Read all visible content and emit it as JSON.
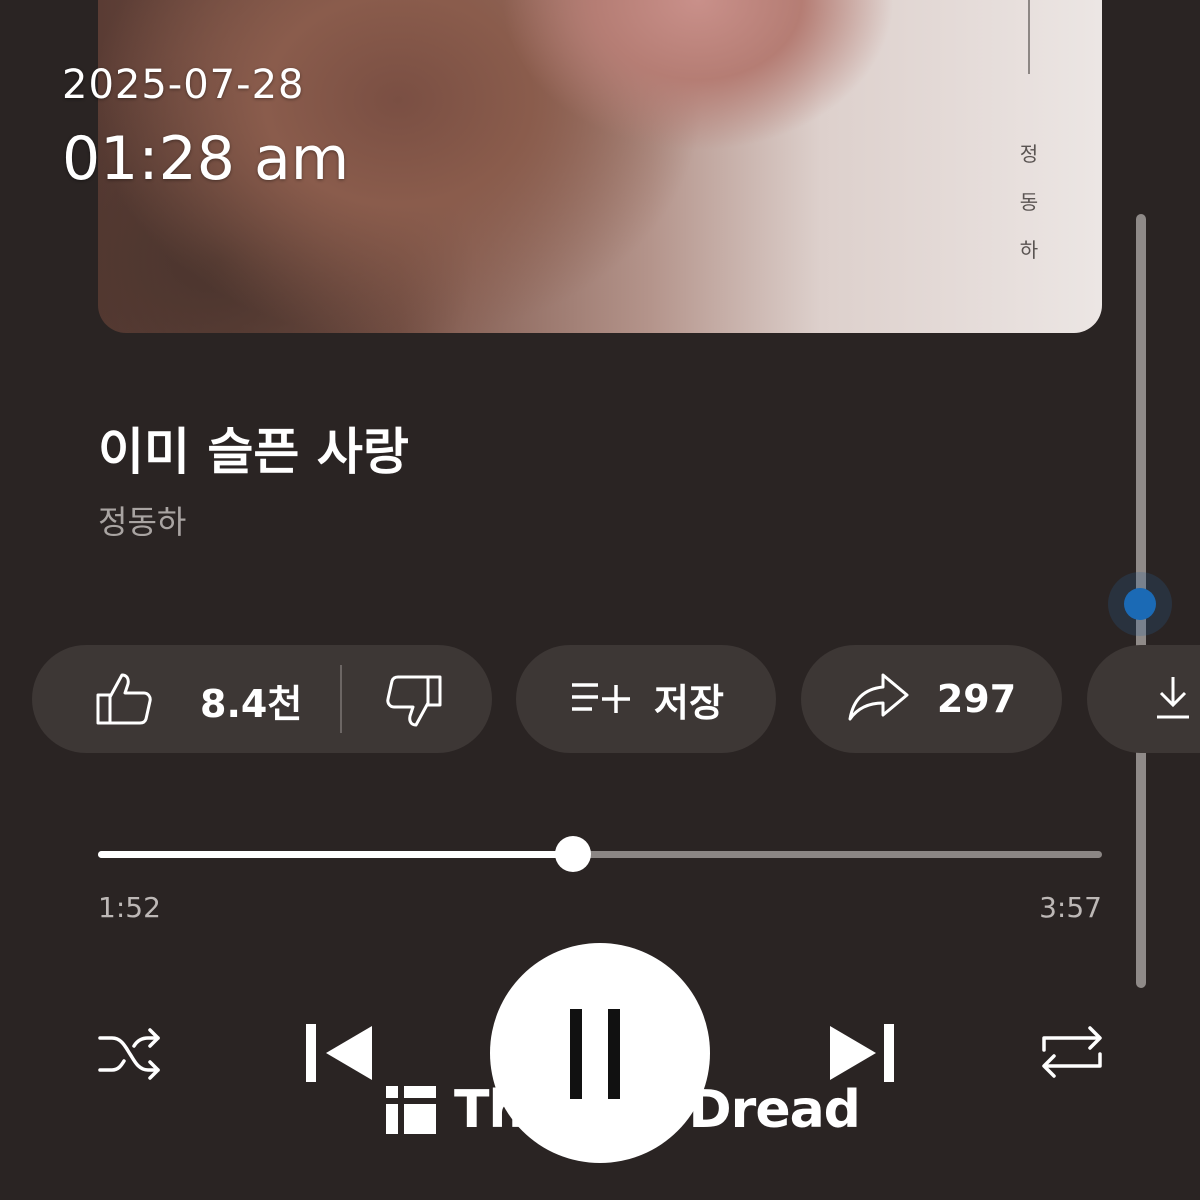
{
  "overlay": {
    "date": "2025-07-28",
    "time": "01:28 am"
  },
  "album_art": {
    "vertical_artist_chars": [
      "정",
      "동",
      "하"
    ]
  },
  "song": {
    "title": "이미 슬픈 사랑",
    "artist": "정동하"
  },
  "actions": {
    "like_count": "8.4천",
    "save_label": "저장",
    "share_count": "297"
  },
  "playback": {
    "elapsed": "1:52",
    "total": "3:57",
    "progress_fraction": 0.473
  },
  "watermark": {
    "text": "TheQoo Dread"
  },
  "icons": {
    "like": "thumbs-up-icon",
    "dislike": "thumbs-down-icon",
    "save": "playlist-add-icon",
    "share": "share-arrow-icon",
    "download": "download-icon",
    "shuffle": "shuffle-icon",
    "previous": "skip-previous-icon",
    "play_pause": "pause-icon",
    "next": "skip-next-icon",
    "repeat": "repeat-icon"
  },
  "colors": {
    "background": "#2a2423",
    "chip": "#3d3735",
    "scroll_thumb": "#1b6ab5",
    "progress_fill": "#ffffff",
    "secondary_text": "#a9a4a2"
  }
}
